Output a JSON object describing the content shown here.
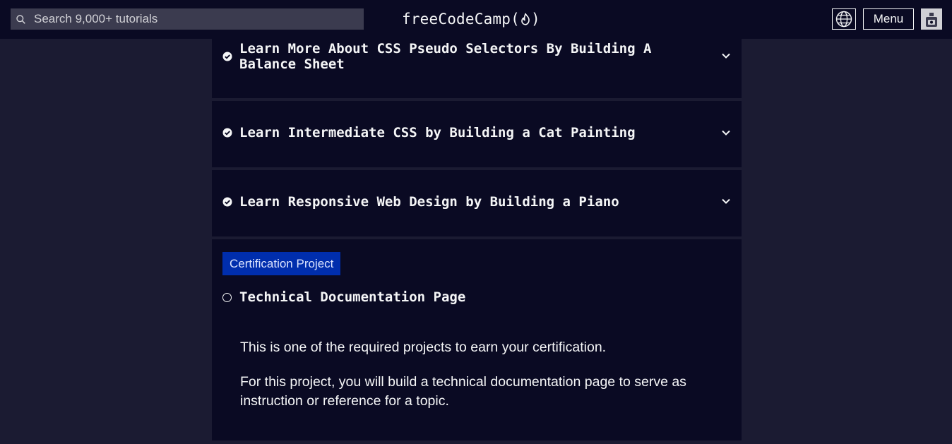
{
  "header": {
    "search_placeholder": "Search 9,000+ tutorials",
    "logo_text": "freeCodeCamp",
    "logo_open": "(",
    "logo_close": ")",
    "menu_label": "Menu"
  },
  "superblocks": [
    {
      "title": "Learn More About CSS Pseudo Selectors By Building A Balance Sheet",
      "completed": true
    },
    {
      "title": "Learn Intermediate CSS by Building a Cat Painting",
      "completed": true
    },
    {
      "title": "Learn Responsive Web Design by Building a Piano",
      "completed": true
    }
  ],
  "certification": {
    "badge": "Certification Project",
    "project_title": "Technical Documentation Page",
    "completed": false,
    "paragraphs": [
      "This is one of the required projects to earn your certification.",
      "For this project, you will build a technical documentation page to serve as instruction or reference for a topic."
    ]
  },
  "colors": {
    "page_bg": "#1b1b32",
    "panel_bg": "#0a0a23",
    "search_bg": "#3b3b4f",
    "badge_bg": "#002ead",
    "text": "#f5f6f7"
  }
}
